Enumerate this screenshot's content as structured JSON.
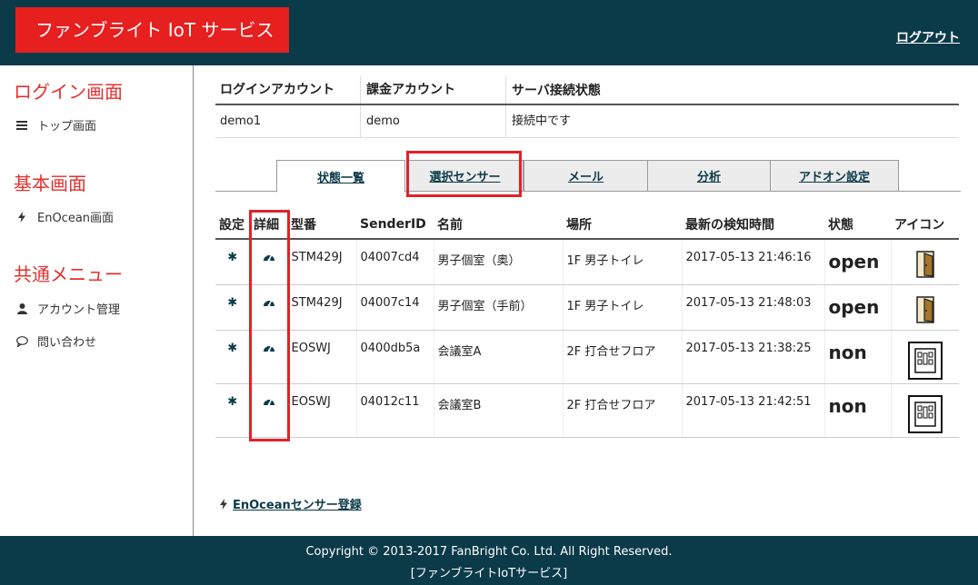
{
  "header": {
    "brand": "ファンブライト IoT サービス",
    "logout": "ログアウト"
  },
  "sidebar": {
    "sections": [
      {
        "title": "ログイン画面",
        "items": [
          {
            "label": "トップ画面",
            "icon": "bars-icon"
          }
        ]
      },
      {
        "title": "基本画面",
        "items": [
          {
            "label": "EnOcean画面",
            "icon": "lightning-icon"
          }
        ]
      },
      {
        "title": "共通メニュー",
        "items": [
          {
            "label": "アカウント管理",
            "icon": "user-icon"
          },
          {
            "label": "問い合わせ",
            "icon": "chat-icon"
          }
        ]
      }
    ]
  },
  "account": {
    "headers": [
      "ログインアカウント",
      "課金アカウント",
      "サーバ接続状態"
    ],
    "values": [
      "demo1",
      "demo",
      "接続中です"
    ]
  },
  "tabs": [
    "状態一覧",
    "選択センサー",
    "メール",
    "分析",
    "アドオン設定"
  ],
  "sensor_table": {
    "headers": [
      "設定",
      "詳細",
      "型番",
      "SenderID",
      "名前",
      "場所",
      "最新の検知時間",
      "状態",
      "アイコン"
    ],
    "rows": [
      {
        "model": "STM429J",
        "sender_id": "04007cd4",
        "name": "男子個室（奥）",
        "place": "1F 男子トイレ",
        "time": "2017-05-13 21:46:16",
        "state": "open",
        "icon": "door-open-icon"
      },
      {
        "model": "STM429J",
        "sender_id": "04007c14",
        "name": "男子個室（手前）",
        "place": "1F 男子トイレ",
        "time": "2017-05-13 21:48:03",
        "state": "open",
        "icon": "door-open-icon"
      },
      {
        "model": "EOSWJ",
        "sender_id": "0400db5a",
        "name": "会議室A",
        "place": "2F 打合せフロア",
        "time": "2017-05-13 21:38:25",
        "state": "non",
        "icon": "room-empty-icon"
      },
      {
        "model": "EOSWJ",
        "sender_id": "04012c11",
        "name": "会議室B",
        "place": "2F 打合せフロア",
        "time": "2017-05-13 21:42:51",
        "state": "non",
        "icon": "room-empty-icon"
      }
    ]
  },
  "register_link": "EnOceanセンサー登録",
  "footer": {
    "line1": "Copyright © 2013-2017 FanBright Co. Ltd. All Right Reserved.",
    "line2": "[ファンブライトIoTサービス]"
  },
  "colors": {
    "header_bg": "#0b3a49",
    "brand_bg": "#e61f1f",
    "accent_red": "#e2302e",
    "highlight": "#e2202a"
  }
}
